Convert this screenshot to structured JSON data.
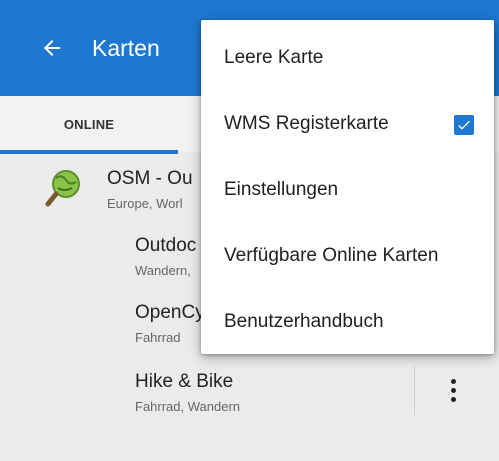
{
  "appbar": {
    "title": "Karten",
    "back_icon": "arrow-left-icon",
    "color": "#1e78d2"
  },
  "tabs": [
    {
      "label": "ONLINE",
      "selected": true
    }
  ],
  "list": {
    "items": [
      {
        "title": "OSM - Ou",
        "subtitle": "Europe, Worl",
        "icon": "map-magnifier-icon"
      },
      {
        "title": "Outdoc",
        "subtitle": "Wandern,"
      },
      {
        "title": "OpenCy",
        "subtitle": "Fahrrad"
      },
      {
        "title": "Hike & Bike",
        "subtitle": "Fahrrad, Wandern"
      }
    ]
  },
  "menu": {
    "items": [
      {
        "label": "Leere Karte"
      },
      {
        "label": "WMS Registerkarte",
        "checked": true
      },
      {
        "label": "Einstellungen"
      },
      {
        "label": "Verfügbare Online Karten"
      },
      {
        "label": "Benutzerhandbuch"
      }
    ]
  }
}
